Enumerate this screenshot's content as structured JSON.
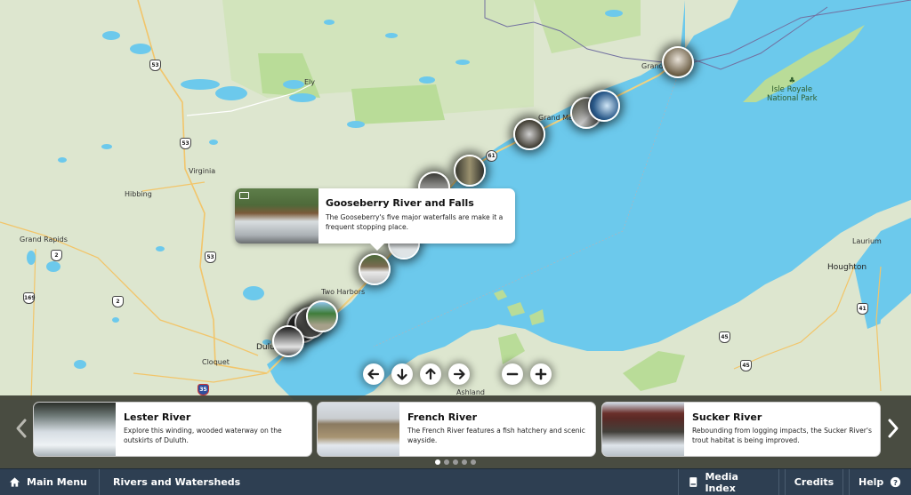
{
  "map": {
    "labels": {
      "ely": "Ely",
      "virginia": "Virginia",
      "hibbing": "Hibbing",
      "grand_rapids": "Grand Rapids",
      "two_harbors": "Two Harbors",
      "duluth": "Dulu",
      "cloquet": "Cloquet",
      "ashland": "Ashland",
      "grand_marais": "Grand Mar",
      "grand_portage": "Grand",
      "isle_royale_1": "Isle Royale",
      "isle_royale_2": "National Park",
      "laurium": "Laurium",
      "houghton": "Houghton"
    },
    "shields": {
      "us53_a": "53",
      "us53_b": "53",
      "us53_c": "53",
      "us2_a": "2",
      "us2_b": "2",
      "us169": "169",
      "i35": "35",
      "mn61": "61",
      "us41": "41",
      "us45_a": "45",
      "us45_b": "45"
    },
    "colors": {
      "water": "#6cc9ec",
      "land": "#dde6cf",
      "park": "#b9dc98",
      "road": "#f2c56a"
    }
  },
  "popup": {
    "title": "Gooseberry River and Falls",
    "description": "The Gooseberry's five major waterfalls are make it a frequent stopping place.",
    "icon": "media-icon"
  },
  "map_controls": {
    "pan_left": "arrow-left-icon",
    "pan_down": "arrow-down-icon",
    "pan_up": "arrow-up-icon",
    "pan_right": "arrow-right-icon",
    "zoom_out": "minus-icon",
    "zoom_in": "plus-icon"
  },
  "carousel": {
    "cards": [
      {
        "title": "Lester River",
        "description": "Explore this winding, wooded waterway on the outskirts of Duluth."
      },
      {
        "title": "French River",
        "description": "The French River features a fish hatchery and scenic wayside."
      },
      {
        "title": "Sucker River",
        "description": "Rebounding from logging impacts, the Sucker River's trout habitat is being improved."
      }
    ],
    "page_count": 5,
    "active_page": 1
  },
  "bottom_bar": {
    "main_menu": "Main Menu",
    "section_title": "Rivers and Watersheds",
    "media_index": "Media Index",
    "credits": "Credits",
    "help": "Help"
  }
}
